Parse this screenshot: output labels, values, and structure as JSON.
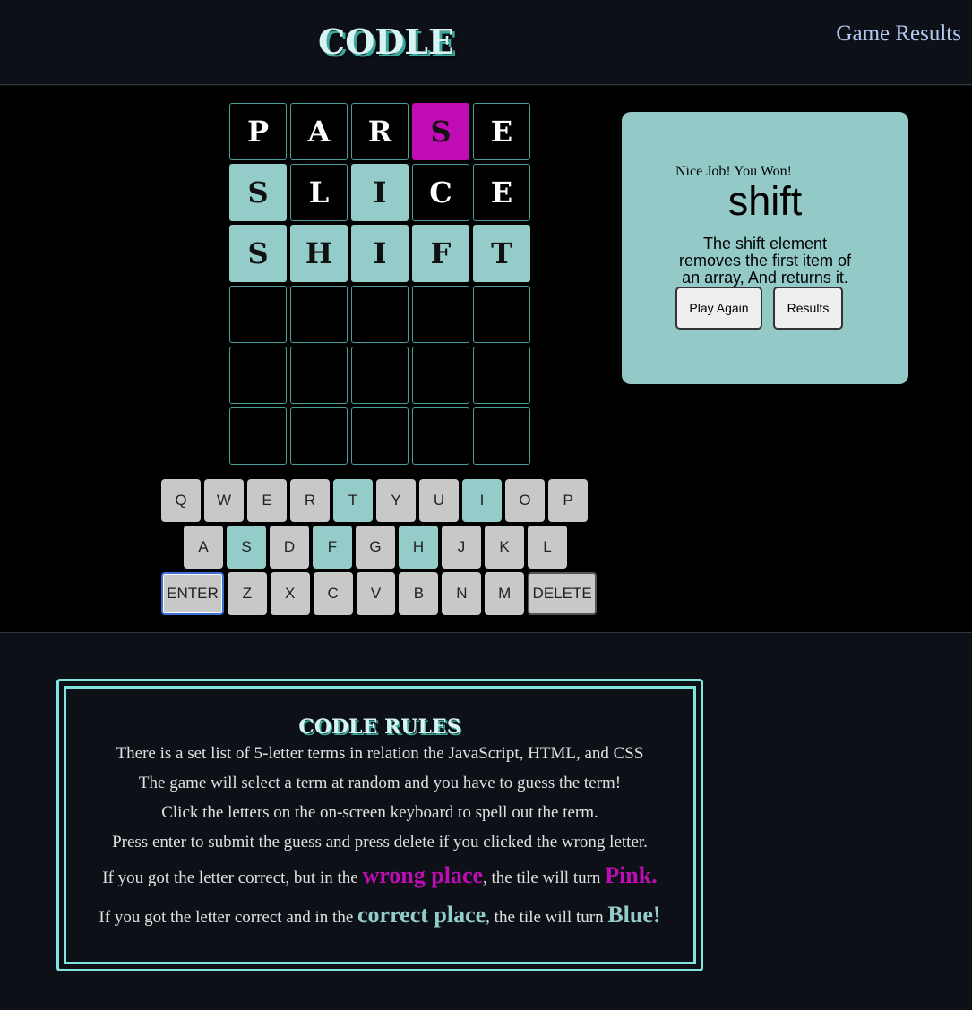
{
  "header": {
    "logo": "CODLE",
    "nav_link": "Game Results"
  },
  "board": {
    "rows": [
      [
        {
          "l": "P",
          "s": "absent"
        },
        {
          "l": "A",
          "s": "absent"
        },
        {
          "l": "R",
          "s": "absent"
        },
        {
          "l": "S",
          "s": "wrong"
        },
        {
          "l": "E",
          "s": "absent"
        }
      ],
      [
        {
          "l": "S",
          "s": "correct"
        },
        {
          "l": "L",
          "s": "absent"
        },
        {
          "l": "I",
          "s": "correct"
        },
        {
          "l": "C",
          "s": "absent"
        },
        {
          "l": "E",
          "s": "absent"
        }
      ],
      [
        {
          "l": "S",
          "s": "correct"
        },
        {
          "l": "H",
          "s": "correct"
        },
        {
          "l": "I",
          "s": "correct"
        },
        {
          "l": "F",
          "s": "correct"
        },
        {
          "l": "T",
          "s": "correct"
        }
      ],
      [
        {
          "l": "",
          "s": "empty"
        },
        {
          "l": "",
          "s": "empty"
        },
        {
          "l": "",
          "s": "empty"
        },
        {
          "l": "",
          "s": "empty"
        },
        {
          "l": "",
          "s": "empty"
        }
      ],
      [
        {
          "l": "",
          "s": "empty"
        },
        {
          "l": "",
          "s": "empty"
        },
        {
          "l": "",
          "s": "empty"
        },
        {
          "l": "",
          "s": "empty"
        },
        {
          "l": "",
          "s": "empty"
        }
      ],
      [
        {
          "l": "",
          "s": "empty"
        },
        {
          "l": "",
          "s": "empty"
        },
        {
          "l": "",
          "s": "empty"
        },
        {
          "l": "",
          "s": "empty"
        },
        {
          "l": "",
          "s": "empty"
        }
      ]
    ]
  },
  "keyboard": {
    "rows": [
      [
        {
          "k": "Q"
        },
        {
          "k": "W"
        },
        {
          "k": "E"
        },
        {
          "k": "R"
        },
        {
          "k": "T",
          "used": true
        },
        {
          "k": "Y"
        },
        {
          "k": "U"
        },
        {
          "k": "I",
          "used": true
        },
        {
          "k": "O"
        },
        {
          "k": "P"
        }
      ],
      [
        {
          "k": "A"
        },
        {
          "k": "S",
          "used": true
        },
        {
          "k": "D"
        },
        {
          "k": "F",
          "used": true
        },
        {
          "k": "G"
        },
        {
          "k": "H",
          "used": true
        },
        {
          "k": "J"
        },
        {
          "k": "K"
        },
        {
          "k": "L"
        }
      ],
      [
        {
          "k": "ENTER",
          "type": "enter"
        },
        {
          "k": "Z"
        },
        {
          "k": "X"
        },
        {
          "k": "C"
        },
        {
          "k": "V"
        },
        {
          "k": "B"
        },
        {
          "k": "N"
        },
        {
          "k": "M"
        },
        {
          "k": "DELETE",
          "type": "delete"
        }
      ]
    ]
  },
  "result": {
    "message": "Nice Job! You Won!",
    "word": "shift",
    "description": "The shift element removes the first item of an array, And returns it.",
    "play_again": "Play Again",
    "results": "Results"
  },
  "rules": {
    "title": "CODLE RULES",
    "line1": "There is a set list of 5-letter terms in relation the JavaScript, HTML, and CSS",
    "line2": "The game will select a term at random and you have to guess the term!",
    "line3": "Click the letters on the on-screen keyboard to spell out the term.",
    "line4": "Press enter to submit the guess and press delete if you clicked the wrong letter.",
    "line5_a": "If you got the letter correct, but in the ",
    "line5_b": "wrong place",
    "line5_c": ", the tile will turn ",
    "line5_d": "Pink.",
    "line6_a": "If you got the letter correct and in the ",
    "line6_b": "correct place",
    "line6_c": ", the tile will turn ",
    "line6_d": "Blue!"
  },
  "colors": {
    "correct": "#93ccc9",
    "wrong": "#c00cb5",
    "accent_border": "#7ee6df"
  }
}
